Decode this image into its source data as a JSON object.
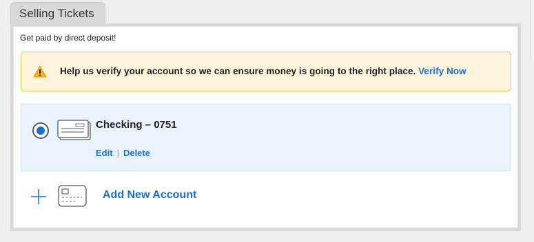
{
  "tab": {
    "label": "Selling Tickets"
  },
  "panel": {
    "subtitle": "Get paid by direct deposit!"
  },
  "alert": {
    "icon": "warning-icon",
    "message": "Help us verify your account so we can ensure money is going to the right place. ",
    "link_label": "Verify Now"
  },
  "account": {
    "name": "Checking – 0751",
    "selected": true,
    "icon": "check-icon",
    "edit_label": "Edit",
    "separator": "|",
    "delete_label": "Delete"
  },
  "add_account": {
    "icon": "plus-icon",
    "card_icon": "card-icon",
    "label": "Add New Account"
  },
  "colors": {
    "accent": "#1a6fd1",
    "alert_bg": "#fcf4dc",
    "alert_border": "#eec34b",
    "selected_bg": "#ebf4fe"
  }
}
